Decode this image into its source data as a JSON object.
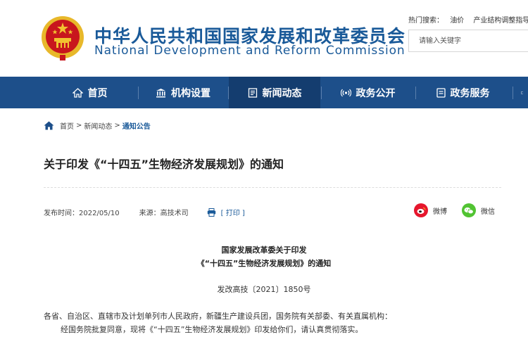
{
  "header": {
    "title_cn": "中华人民共和国国家发展和改革委员会",
    "title_en": "National Development and Reform Commission",
    "hot_label": "热门搜索：",
    "hot_searches": [
      "油价",
      "产业结构调整指导"
    ],
    "search_placeholder": "请输入关键字"
  },
  "nav": {
    "items": [
      {
        "label": "首页",
        "icon": "home-icon"
      },
      {
        "label": "机构设置",
        "icon": "institution-icon"
      },
      {
        "label": "新闻动态",
        "icon": "news-icon"
      },
      {
        "label": "政务公开",
        "icon": "broadcast-icon"
      },
      {
        "label": "政务服务",
        "icon": "service-icon"
      }
    ],
    "active_index": 2
  },
  "breadcrumb": {
    "items": [
      "首页",
      "新闻动态",
      "通知公告"
    ],
    "separator": ">"
  },
  "article": {
    "title": "关于印发《“十四五”生物经济发展规划》的通知",
    "publish_time": "发布时间：2022/05/10",
    "source": "来源：高技术司",
    "print_label": "[ 打印 ]",
    "share": [
      {
        "label": "微博",
        "icon": "weibo-icon",
        "color": "#e6162d"
      },
      {
        "label": "微信",
        "icon": "wechat-icon",
        "color": "#51c332"
      }
    ],
    "heading_line1": "国家发展改革委关于印发",
    "heading_line2": "《“十四五”生物经济发展规划》的通知",
    "doc_number": "发改高技〔2021〕1850号",
    "recipients": "各省、自治区、直辖市及计划单列市人民政府，新疆生产建设兵团，国务院有关部委、有关直属机构：",
    "body_line1": "经国务院批复同意，现将《“十四五”生物经济发展规划》印发给你们，请认真贯彻落实。"
  },
  "colors": {
    "brand_blue": "#1a5a99",
    "nav_bg": "#1d4f8a",
    "nav_active_bg": "#143d6f",
    "emblem_red": "#c8161d",
    "emblem_gold": "#f2c230"
  }
}
